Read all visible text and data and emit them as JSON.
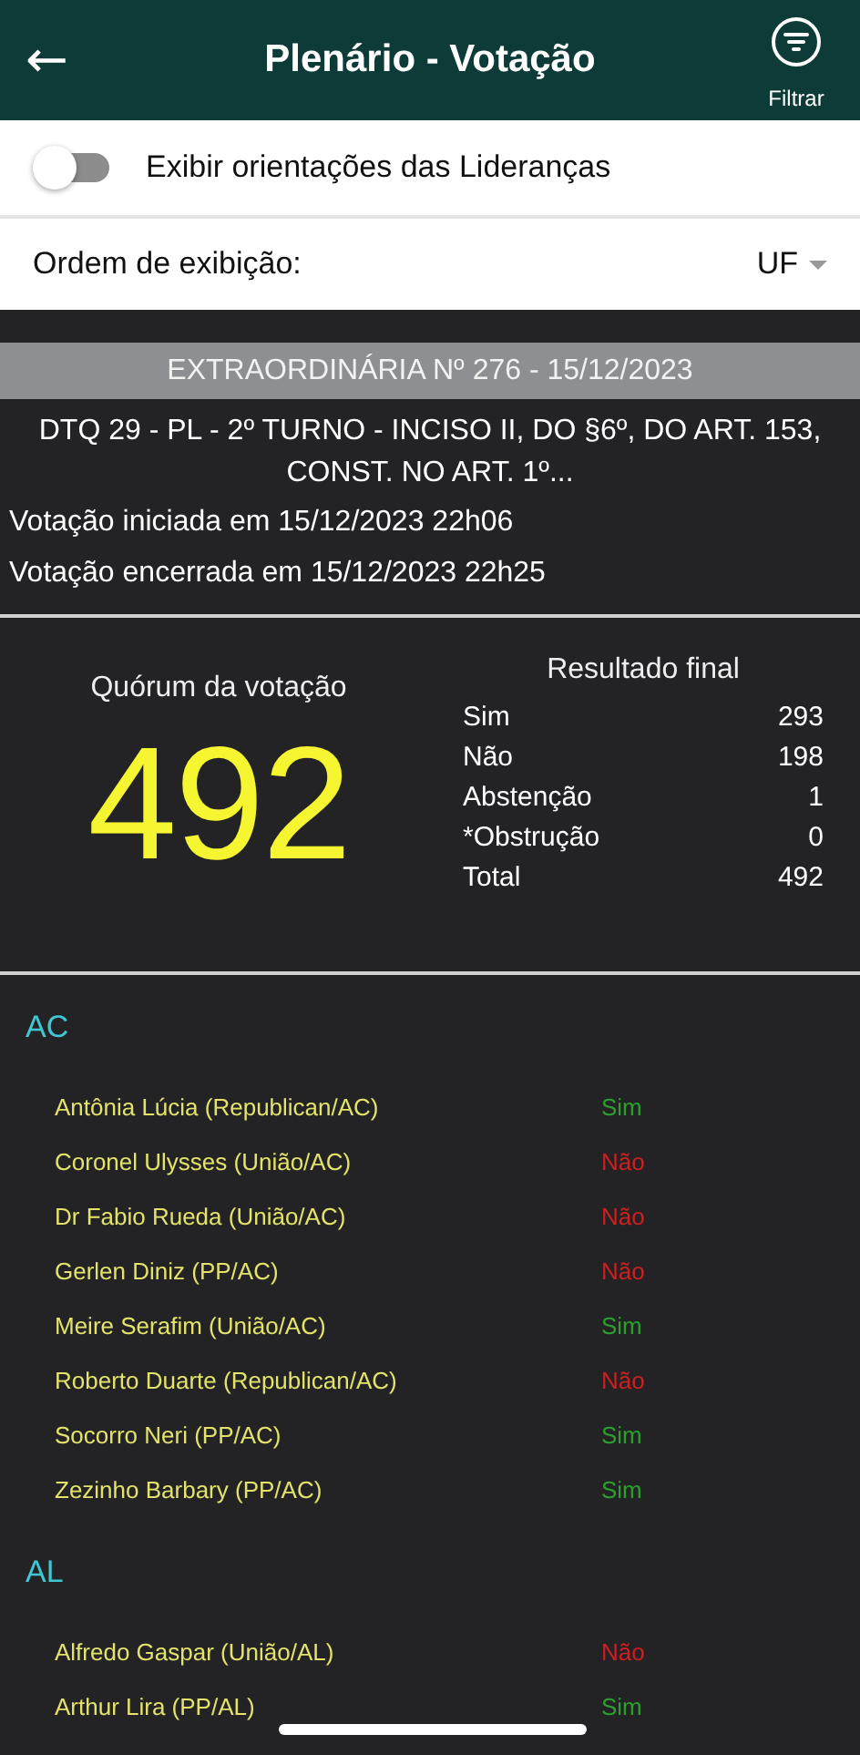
{
  "header": {
    "back": "←",
    "title": "Plenário - Votação",
    "filter_label": "Filtrar"
  },
  "leaders_toggle": {
    "label": "Exibir orientações das Lideranças",
    "on": false
  },
  "order": {
    "label": "Ordem de exibição:",
    "value": "UF"
  },
  "session": {
    "banner": "EXTRAORDINÁRIA Nº 276 - 15/12/2023",
    "description": "DTQ 29 - PL - 2º TURNO - INCISO II, DO §6º, DO ART. 153, CONST. NO ART. 1º...",
    "started": "Votação iniciada em 15/12/2023 22h06",
    "ended": "Votação encerrada em 15/12/2023 22h25"
  },
  "quorum": {
    "label": "Quórum da votação",
    "value": "492"
  },
  "result": {
    "title": "Resultado final",
    "rows": [
      {
        "label": "Sim",
        "value": "293"
      },
      {
        "label": "Não",
        "value": "198"
      },
      {
        "label": "Abstenção",
        "value": "1"
      },
      {
        "label": "*Obstrução",
        "value": "0"
      },
      {
        "label": "Total",
        "value": "492"
      }
    ]
  },
  "groups": [
    {
      "state": "AC",
      "votes": [
        {
          "name": "Antônia Lúcia (Republican/AC)",
          "vote": "Sim",
          "kind": "yes"
        },
        {
          "name": "Coronel Ulysses (União/AC)",
          "vote": "Não",
          "kind": "no"
        },
        {
          "name": "Dr Fabio Rueda (União/AC)",
          "vote": "Não",
          "kind": "no"
        },
        {
          "name": "Gerlen Diniz (PP/AC)",
          "vote": "Não",
          "kind": "no"
        },
        {
          "name": "Meire Serafim (União/AC)",
          "vote": "Sim",
          "kind": "yes"
        },
        {
          "name": "Roberto Duarte (Republican/AC)",
          "vote": "Não",
          "kind": "no"
        },
        {
          "name": "Socorro Neri (PP/AC)",
          "vote": "Sim",
          "kind": "yes"
        },
        {
          "name": "Zezinho Barbary (PP/AC)",
          "vote": "Sim",
          "kind": "yes"
        }
      ]
    },
    {
      "state": "AL",
      "votes": [
        {
          "name": "Alfredo Gaspar (União/AL)",
          "vote": "Não",
          "kind": "no"
        },
        {
          "name": "Arthur Lira (PP/AL)",
          "vote": "Sim",
          "kind": "yes"
        }
      ]
    }
  ]
}
